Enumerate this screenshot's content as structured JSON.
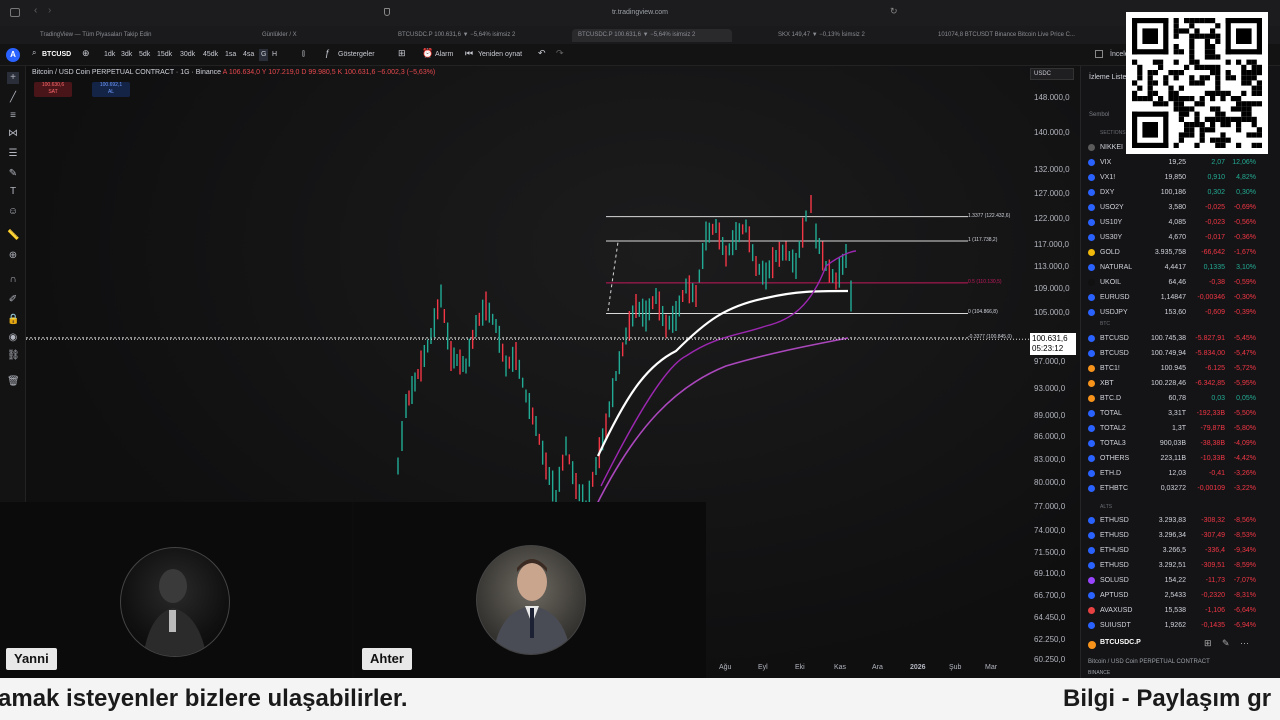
{
  "browser": {
    "url": "tr.tradingview.com",
    "tabs": [
      "TradingView — Tüm Piyasaları Takip Edin",
      "Günlükler / X",
      "BTCUSDC.P 100.631,6 ▼ −5,64% isimsiz 2",
      "BTCUSDC.P 100.631,6 ▼ −5,64% isimsiz 2",
      "SKX 149,47 ▼ −0,13% İsimsiz 2",
      "101074,8 BTCUSDT Binance Bitcoin Live Price C..."
    ]
  },
  "toolbar": {
    "symbol": "BTCUSD",
    "intervals": [
      "1dk",
      "3dk",
      "5dk",
      "15dk",
      "30dk",
      "45dk",
      "1sa",
      "4sa",
      "G",
      "H"
    ],
    "indicators_label": "Göstergeler",
    "alarm_label": "Alarm",
    "replay_label": "Yeniden oynat",
    "right_label": "İnceleme"
  },
  "chart": {
    "legend_title": "Bitcoin / USD Coin PERPETUAL CONTRACT · 1G · Binance",
    "ohlc": "A 106.634,0  Y 107.219,0  D 99.980,5  K 100.631,6  −6.002,3 (−5,63%)",
    "sell_price": "100.630,6",
    "sell_label": "SAT",
    "buy_price": "100.692,1",
    "buy_label": "AL",
    "quote_currency": "USDC",
    "current_price": "100.631,6",
    "countdown": "05:23:12",
    "price_ticks": [
      "148.000,0",
      "140.000,0",
      "132.000,0",
      "127.000,0",
      "122.000,0",
      "117.000,0",
      "113.000,0",
      "109.000,0",
      "105.000,0",
      "97.000,0",
      "93.000,0",
      "89.000,0",
      "86.000,0",
      "83.000,0",
      "80.000,0",
      "77.000,0",
      "74.000,0",
      "71.500,0",
      "69.100,0",
      "66.700,0",
      "64.450,0",
      "62.250,0",
      "60.250,0"
    ],
    "time_ticks": [
      "Ağu",
      "Eyl",
      "Eki",
      "Kas",
      "Ara",
      "2026",
      "Şub",
      "Mar"
    ],
    "fib_labels": [
      "1.3377 (122.432,6)",
      "1 (117.738,2)",
      "0.5 (110.130,5)",
      "0 (104.866,8)",
      "-0.3377 (100.845,0)"
    ],
    "chart_data": {
      "type": "line",
      "title": "Bitcoin / USD Coin PERPETUAL CONTRACT · 1G · Binance",
      "xlabel": "",
      "ylabel": "",
      "x": [
        "Ağu",
        "Eyl",
        "Eki",
        "Kas",
        "Ara",
        "2026",
        "Şub",
        "Mar"
      ],
      "ylim": [
        60250,
        148000
      ],
      "log_scale": true,
      "series": [],
      "horizontal_levels": [
        122432.6,
        117738.2,
        110130.5,
        104866.8,
        100845.0
      ],
      "last_price": 100631.6
    }
  },
  "cams": {
    "left_name": "Yanni",
    "right_name": "Ahter"
  },
  "watchlist": {
    "title": "İzleme Listesi",
    "symbol_header": "Sembol",
    "sections": [
      "SECTIONS",
      "BTC",
      "ALTS"
    ],
    "rows": [
      {
        "sym": "NIKKEI",
        "last": "",
        "chg": "",
        "pct": "",
        "color": "#5b5b5b",
        "dir": "neg"
      },
      {
        "sym": "VIX",
        "last": "19,25",
        "chg": "2,07",
        "pct": "12,06%",
        "color": "#2962ff",
        "dir": "pos"
      },
      {
        "sym": "VX1!",
        "last": "19,850",
        "chg": "0,910",
        "pct": "4,82%",
        "color": "#2962ff",
        "dir": "pos"
      },
      {
        "sym": "DXY",
        "last": "100,186",
        "chg": "0,302",
        "pct": "0,30%",
        "color": "#2962ff",
        "dir": "pos"
      },
      {
        "sym": "USO2Y",
        "last": "3,580",
        "chg": "-0,025",
        "pct": "-0,69%",
        "color": "#2962ff",
        "dir": "neg"
      },
      {
        "sym": "US10Y",
        "last": "4,085",
        "chg": "-0,023",
        "pct": "-0,56%",
        "color": "#2962ff",
        "dir": "neg"
      },
      {
        "sym": "US30Y",
        "last": "4,670",
        "chg": "-0,017",
        "pct": "-0,36%",
        "color": "#2962ff",
        "dir": "neg"
      },
      {
        "sym": "GOLD",
        "last": "3.935,758",
        "chg": "-66,642",
        "pct": "-1,67%",
        "color": "#f0b90b",
        "dir": "neg"
      },
      {
        "sym": "NATURAL",
        "last": "4,4417",
        "chg": "0,1335",
        "pct": "3,10%",
        "color": "#2962ff",
        "dir": "pos"
      },
      {
        "sym": "UKOIL",
        "last": "64,46",
        "chg": "-0,38",
        "pct": "-0,59%",
        "color": "#111111",
        "dir": "neg"
      },
      {
        "sym": "EURUSD",
        "last": "1,14847",
        "chg": "-0,00346",
        "pct": "-0,30%",
        "color": "#2962ff",
        "dir": "neg"
      },
      {
        "sym": "USDJPY",
        "last": "153,60",
        "chg": "-0,609",
        "pct": "-0,39%",
        "color": "#2962ff",
        "dir": "neg"
      },
      {
        "sym": "BTCUSD",
        "last": "100.745,38",
        "chg": "-5.827,91",
        "pct": "-5,45%",
        "color": "#2962ff",
        "dir": "neg"
      },
      {
        "sym": "BTCUSD",
        "last": "100.749,94",
        "chg": "-5.834,00",
        "pct": "-5,47%",
        "color": "#2962ff",
        "dir": "neg"
      },
      {
        "sym": "BTC1!",
        "last": "100.945",
        "chg": "-6.125",
        "pct": "-5,72%",
        "color": "#f7931a",
        "dir": "neg"
      },
      {
        "sym": "XBT",
        "last": "100.228,46",
        "chg": "-6.342,85",
        "pct": "-5,95%",
        "color": "#f7931a",
        "dir": "neg"
      },
      {
        "sym": "BTC.D",
        "last": "60,78",
        "chg": "0,03",
        "pct": "0,05%",
        "color": "#f7931a",
        "dir": "pos"
      },
      {
        "sym": "TOTAL",
        "last": "3,31T",
        "chg": "-192,33B",
        "pct": "-5,50%",
        "color": "#2962ff",
        "dir": "neg"
      },
      {
        "sym": "TOTAL2",
        "last": "1,3T",
        "chg": "-79,87B",
        "pct": "-5,80%",
        "color": "#2962ff",
        "dir": "neg"
      },
      {
        "sym": "TOTAL3",
        "last": "900,03B",
        "chg": "-38,38B",
        "pct": "-4,09%",
        "color": "#2962ff",
        "dir": "neg"
      },
      {
        "sym": "OTHERS",
        "last": "223,11B",
        "chg": "-10,33B",
        "pct": "-4,42%",
        "color": "#2962ff",
        "dir": "neg"
      },
      {
        "sym": "ETH.D",
        "last": "12,03",
        "chg": "-0,41",
        "pct": "-3,26%",
        "color": "#2962ff",
        "dir": "neg"
      },
      {
        "sym": "ETHBTC",
        "last": "0,03272",
        "chg": "-0,00109",
        "pct": "-3,22%",
        "color": "#2962ff",
        "dir": "neg"
      },
      {
        "sym": "ETHUSD",
        "last": "3.293,83",
        "chg": "-308,32",
        "pct": "-8,56%",
        "color": "#2962ff",
        "dir": "neg"
      },
      {
        "sym": "ETHUSD",
        "last": "3.296,34",
        "chg": "-307,49",
        "pct": "-8,53%",
        "color": "#2962ff",
        "dir": "neg"
      },
      {
        "sym": "ETHUSD",
        "last": "3.266,5",
        "chg": "-336,4",
        "pct": "-9,34%",
        "color": "#2962ff",
        "dir": "neg"
      },
      {
        "sym": "ETHUSD",
        "last": "3.292,51",
        "chg": "-309,51",
        "pct": "-8,59%",
        "color": "#2962ff",
        "dir": "neg"
      },
      {
        "sym": "SOLUSD",
        "last": "154,22",
        "chg": "-11,73",
        "pct": "-7,07%",
        "color": "#9945ff",
        "dir": "neg"
      },
      {
        "sym": "APTUSD",
        "last": "2,5433",
        "chg": "-0,2320",
        "pct": "-8,31%",
        "color": "#2962ff",
        "dir": "neg"
      },
      {
        "sym": "AVAXUSD",
        "last": "15,538",
        "chg": "-1,106",
        "pct": "-6,64%",
        "color": "#e84142",
        "dir": "neg"
      },
      {
        "sym": "SUIUSDT",
        "last": "1,9262",
        "chg": "-0,1435",
        "pct": "-6,94%",
        "color": "#2962ff",
        "dir": "neg"
      }
    ],
    "card_symbol": "BTCUSDC.P",
    "card_desc": "Bitcoin / USD Coin PERPETUAL CONTRACT",
    "card_exchange": "BINANCE"
  },
  "ticker": {
    "left_text": "amak isteyenler bizlere ulaşabilirler.",
    "right_text": "Bilgi - Paylaşım gr"
  }
}
